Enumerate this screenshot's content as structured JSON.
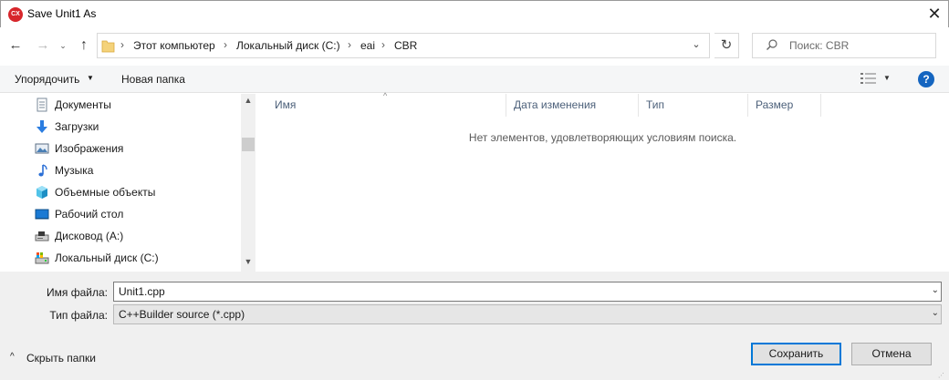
{
  "window": {
    "title": "Save Unit1 As",
    "app_icon_text": "CX",
    "close_glyph": "✕"
  },
  "nav": {
    "back_glyph": "←",
    "forward_glyph": "→",
    "recent_glyph": "⌄",
    "up_glyph": "↑",
    "breadcrumb": [
      "Этот компьютер",
      "Локальный диск (C:)",
      "eai",
      "CBR"
    ],
    "separator": "›",
    "refresh_glyph": "↻",
    "search_placeholder": "Поиск: CBR"
  },
  "toolbar": {
    "organize_label": "Упорядочить",
    "new_folder_label": "Новая папка",
    "help_glyph": "?"
  },
  "sidebar": {
    "items": [
      {
        "label": "Документы",
        "icon": "documents-icon"
      },
      {
        "label": "Загрузки",
        "icon": "downloads-icon"
      },
      {
        "label": "Изображения",
        "icon": "pictures-icon"
      },
      {
        "label": "Музыка",
        "icon": "music-icon"
      },
      {
        "label": "Объемные объекты",
        "icon": "3d-objects-icon"
      },
      {
        "label": "Рабочий стол",
        "icon": "desktop-icon"
      },
      {
        "label": "Дисковод (A:)",
        "icon": "floppy-drive-icon"
      },
      {
        "label": "Локальный диск (C:)",
        "icon": "local-disk-icon"
      }
    ]
  },
  "file_list": {
    "columns": [
      "Имя",
      "Дата изменения",
      "Тип",
      "Размер"
    ],
    "empty_message": "Нет элементов, удовлетворяющих условиям поиска."
  },
  "form": {
    "filename_label": "Имя файла:",
    "filename_value": "Unit1.cpp",
    "filetype_label": "Тип файла:",
    "filetype_value": "C++Builder source (*.cpp)"
  },
  "footer": {
    "hide_folders_label": "Скрыть папки",
    "save_label": "Сохранить",
    "cancel_label": "Отмена"
  },
  "colors": {
    "accent": "#0078d7",
    "help_blue": "#1565c0",
    "app_icon_red": "#d7262b",
    "column_header_text": "#4c607a"
  }
}
